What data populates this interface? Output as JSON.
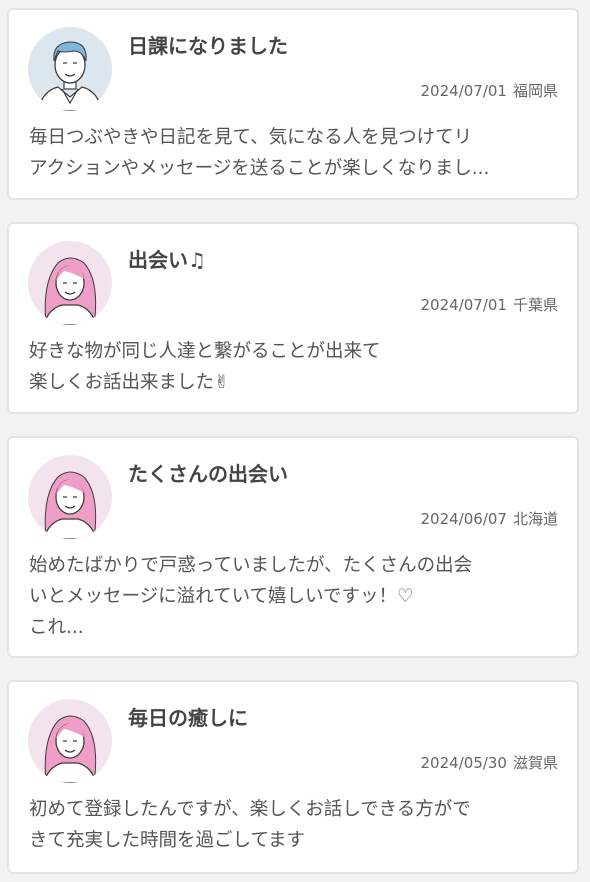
{
  "reviews": [
    {
      "avatar_icon": "man-avatar-icon",
      "title": "日課になりました",
      "date": "2024/07/01",
      "location": "福岡県",
      "body": "毎日つぶやきや日記を見て、気になる人を見つけてリ\nアクションやメッセージを送ることが楽しくなりまし..."
    },
    {
      "avatar_icon": "woman-avatar-icon",
      "title": "出会い♫",
      "date": "2024/07/01",
      "location": "千葉県",
      "body": "好きな物が同じ人達と繋がることが出来て\n楽しくお話出来ました✌"
    },
    {
      "avatar_icon": "woman-avatar-icon",
      "title": "たくさんの出会い",
      "date": "2024/06/07",
      "location": "北海道",
      "body": "始めたばかりで戸惑っていましたが、たくさんの出会\nいとメッセージに溢れていて嬉しいですッ！♡\nこれ..."
    },
    {
      "avatar_icon": "woman-avatar-icon",
      "title": "毎日の癒しに",
      "date": "2024/05/30",
      "location": "滋賀県",
      "body": "初めて登録したんですが、楽しくお話しできる方がで\nきて充実した時間を過ごしてます"
    }
  ],
  "colors": {
    "man_avatar_bg": "#dbe6ee",
    "woman_avatar_bg": "#f3e3ef",
    "man_hair": "#7eb6d9",
    "woman_hair": "#ee9ec7",
    "outline": "#3c3c3c"
  }
}
